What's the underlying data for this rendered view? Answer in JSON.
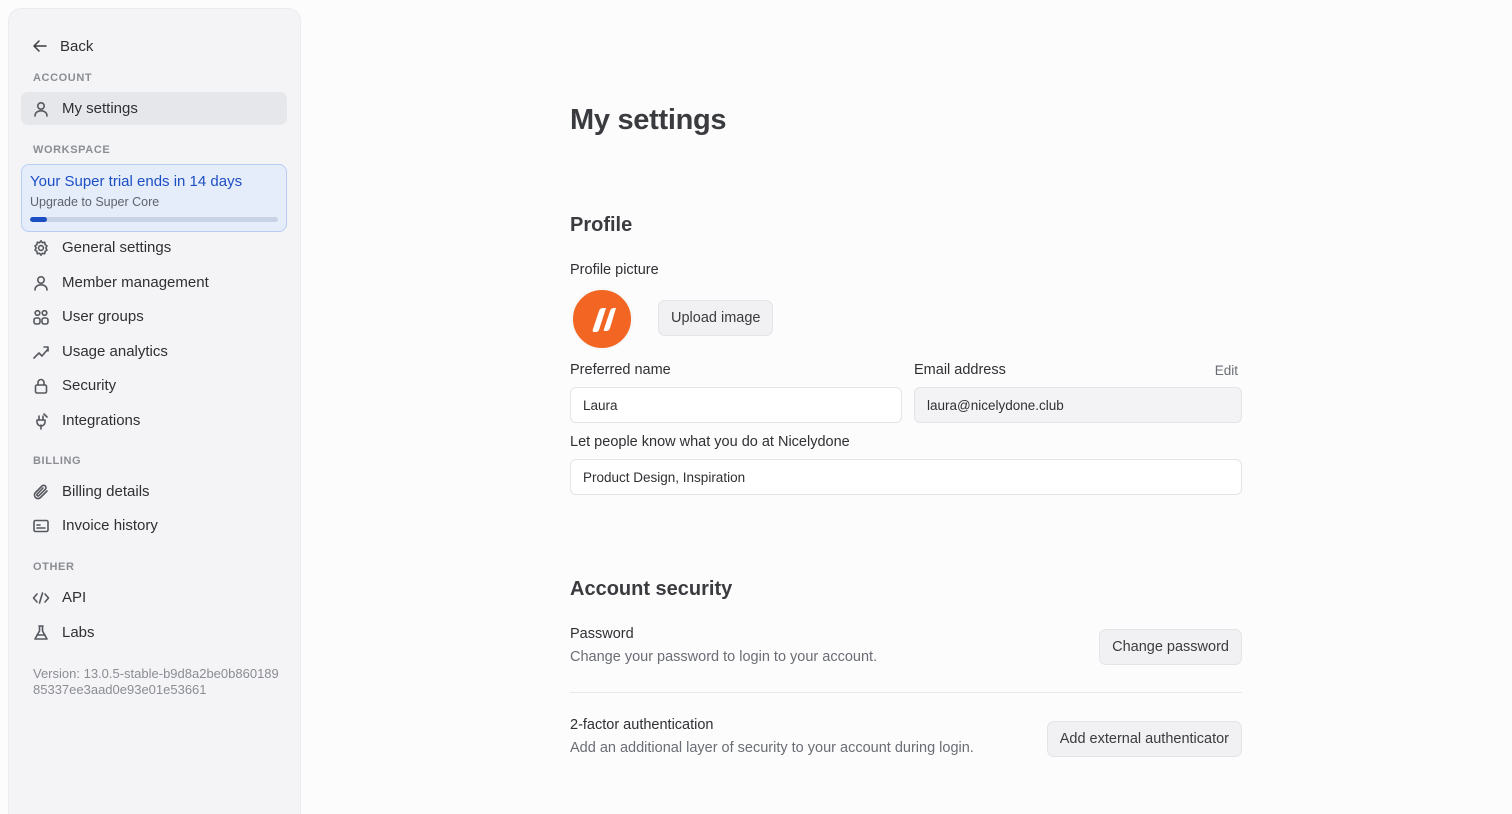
{
  "sidebar": {
    "back_label": "Back",
    "sections": {
      "account": "ACCOUNT",
      "workspace": "WORKSPACE",
      "billing": "BILLING",
      "other": "OTHER"
    },
    "items": {
      "my_settings": "My settings",
      "general_settings": "General settings",
      "member_management": "Member management",
      "user_groups": "User groups",
      "usage_analytics": "Usage analytics",
      "security": "Security",
      "integrations": "Integrations",
      "billing_details": "Billing details",
      "invoice_history": "Invoice history",
      "api": "API",
      "labs": "Labs"
    },
    "trial": {
      "title": "Your Super trial ends in 14 days",
      "subtitle": "Upgrade to Super Core",
      "progress_fraction": 0.07
    },
    "version": "Version: 13.0.5-stable-b9d8a2be0b86018985337ee3aad0e93e01e53661"
  },
  "main": {
    "title": "My settings",
    "profile": {
      "heading": "Profile",
      "picture_label": "Profile picture",
      "upload_label": "Upload image",
      "preferred_name_label": "Preferred name",
      "preferred_name_value": "Laura",
      "email_label": "Email address",
      "email_edit": "Edit",
      "email_value": "laura@nicelydone.club",
      "role_label": "Let people know what you do at Nicelydone",
      "role_value": "Product Design, Inspiration"
    },
    "security": {
      "heading": "Account security",
      "password_title": "Password",
      "password_desc": "Change your password to login to your account.",
      "password_button": "Change password",
      "twofa_title": "2-factor authentication",
      "twofa_desc": "Add an additional layer of security to your account during login.",
      "twofa_button": "Add external authenticator"
    }
  },
  "colors": {
    "accent": "#1d4fc4",
    "avatar": "#f26522"
  }
}
